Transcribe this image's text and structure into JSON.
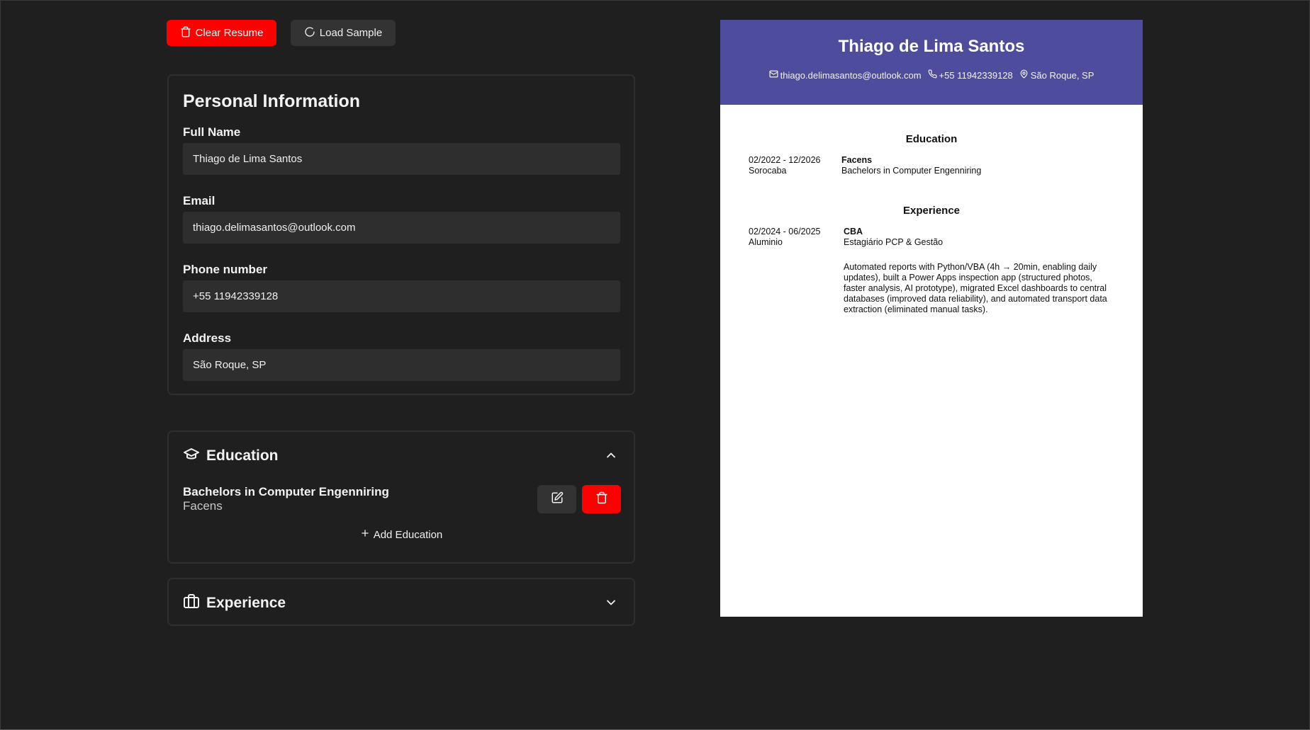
{
  "toolbar": {
    "clear_label": "Clear Resume",
    "load_label": "Load Sample"
  },
  "personal": {
    "title": "Personal Information",
    "full_name_label": "Full Name",
    "full_name": "Thiago de Lima Santos",
    "email_label": "Email",
    "email": "thiago.delimasantos@outlook.com",
    "phone_label": "Phone number",
    "phone": "+55 11942339128",
    "address_label": "Address",
    "address": "São Roque, SP"
  },
  "education_panel": {
    "title": "Education",
    "expanded": true,
    "items": [
      {
        "degree": "Bachelors in Computer Engenniring",
        "school": "Facens"
      }
    ],
    "add_label": "Add Education"
  },
  "experience_panel": {
    "title": "Experience",
    "expanded": false
  },
  "resume": {
    "name": "Thiago de Lima Santos",
    "email": "thiago.delimasantos@outlook.com",
    "phone": "+55 11942339128",
    "address": "São Roque, SP",
    "header_color": "#4e4c9c",
    "education_title": "Education",
    "education": [
      {
        "dates": "02/2022 - 12/2026",
        "location": "Sorocaba",
        "school": "Facens",
        "degree": "Bachelors in Computer Engenniring"
      }
    ],
    "experience_title": "Experience",
    "experience": [
      {
        "dates": "02/2024 - 06/2025",
        "location": "Aluminio",
        "company": "CBA",
        "position": "Estagiário PCP & Gestão",
        "description": "Automated reports with Python/VBA (4h → 20min, enabling daily updates), built a Power Apps inspection app (structured photos, faster analysis, AI prototype), migrated Excel dashboards to central databases (improved data reliability), and automated transport data extraction (eliminated manual tasks)."
      }
    ]
  },
  "colors": {
    "background": "#1f1f1f",
    "danger": "#ff0000",
    "button_dark": "#333333",
    "input_bg": "#2e2e2e"
  }
}
